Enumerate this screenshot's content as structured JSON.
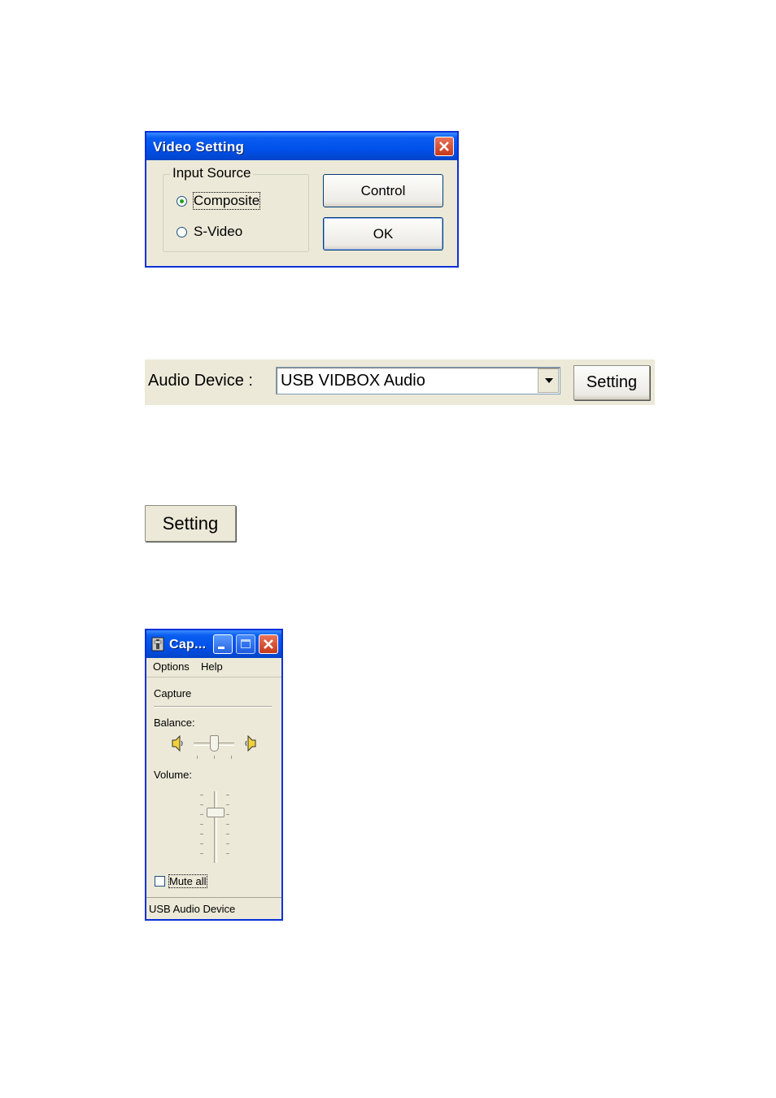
{
  "video_setting": {
    "title": "Video Setting",
    "input_source_label": "Input Source",
    "options": [
      "Composite",
      "S-Video"
    ],
    "selected": "Composite",
    "control_button": "Control",
    "ok_button": "OK"
  },
  "audio_device": {
    "label": "Audio Device :",
    "selected_device": "USB VIDBOX Audio",
    "setting_button": "Setting"
  },
  "standalone_setting_button": "Setting",
  "mixer": {
    "title": "Cap...",
    "menu": [
      "Options",
      "Help"
    ],
    "section": "Capture",
    "balance_label": "Balance:",
    "balance_level": 0.5,
    "volume_label": "Volume:",
    "volume_level": 0.7,
    "mute_label": "Mute all",
    "mute_checked": false,
    "status": "USB Audio Device"
  },
  "colors": {
    "xp_face": "#ece9d8",
    "xp_title_blue": "#0050ea",
    "xp_close_red": "#c7391b"
  }
}
